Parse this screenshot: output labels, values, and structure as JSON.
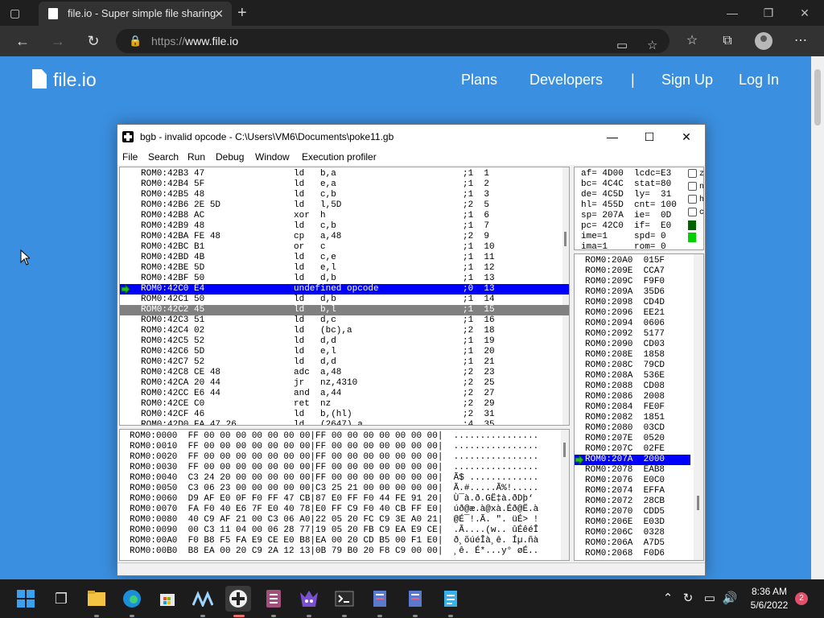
{
  "browser": {
    "tab_title": "file.io - Super simple file sharing",
    "url_scheme": "https://",
    "url_host": "www.file.io",
    "icons": [
      "tab-actions-icon",
      "close-icon",
      "new-tab-icon",
      "back-icon",
      "forward-icon",
      "refresh-icon",
      "lock-icon",
      "immersive-reader-icon",
      "add-favorite-icon",
      "favorites-icon",
      "collections-icon",
      "profile-icon",
      "more-icon"
    ]
  },
  "site": {
    "logo_text": "file.io",
    "nav": [
      "Plans",
      "Developers",
      "|",
      "Sign Up",
      "Log In"
    ]
  },
  "bgb": {
    "title": "bgb - invalid opcode - C:\\Users\\VM6\\Documents\\poke11.gb",
    "menu": [
      "File",
      "Search",
      "Run",
      "Debug",
      "Window",
      "Execution profiler"
    ],
    "disasm": [
      {
        "addr": "ROM0:42B3 47",
        "op": "ld   b,a",
        "cyc": ";1  1"
      },
      {
        "addr": "ROM0:42B4 5F",
        "op": "ld   e,a",
        "cyc": ";1  2"
      },
      {
        "addr": "ROM0:42B5 48",
        "op": "ld   c,b",
        "cyc": ";1  3"
      },
      {
        "addr": "ROM0:42B6 2E 5D",
        "op": "ld   l,5D",
        "cyc": ";2  5"
      },
      {
        "addr": "ROM0:42B8 AC",
        "op": "xor  h",
        "cyc": ";1  6"
      },
      {
        "addr": "ROM0:42B9 48",
        "op": "ld   c,b",
        "cyc": ";1  7"
      },
      {
        "addr": "ROM0:42BA FE 48",
        "op": "cp   a,48",
        "cyc": ";2  9"
      },
      {
        "addr": "ROM0:42BC B1",
        "op": "or   c",
        "cyc": ";1  10"
      },
      {
        "addr": "ROM0:42BD 4B",
        "op": "ld   c,e",
        "cyc": ";1  11"
      },
      {
        "addr": "ROM0:42BE 5D",
        "op": "ld   e,l",
        "cyc": ";1  12"
      },
      {
        "addr": "ROM0:42BF 50",
        "op": "ld   d,b",
        "cyc": ";1  13"
      },
      {
        "addr": "ROM0:42C0 E4",
        "op": "undefined opcode",
        "cyc": ";0  13",
        "state": "selected"
      },
      {
        "addr": "ROM0:42C1 50",
        "op": "ld   d,b",
        "cyc": ";1  14"
      },
      {
        "addr": "ROM0:42C2 45",
        "op": "ld   b,l",
        "cyc": ";1  15",
        "state": "grey"
      },
      {
        "addr": "ROM0:42C3 51",
        "op": "ld   d,c",
        "cyc": ";1  16"
      },
      {
        "addr": "ROM0:42C4 02",
        "op": "ld   (bc),a",
        "cyc": ";2  18"
      },
      {
        "addr": "ROM0:42C5 52",
        "op": "ld   d,d",
        "cyc": ";1  19"
      },
      {
        "addr": "ROM0:42C6 5D",
        "op": "ld   e,l",
        "cyc": ";1  20"
      },
      {
        "addr": "ROM0:42C7 52",
        "op": "ld   d,d",
        "cyc": ";1  21"
      },
      {
        "addr": "ROM0:42C8 CE 48",
        "op": "adc  a,48",
        "cyc": ";2  23"
      },
      {
        "addr": "ROM0:42CA 20 44",
        "op": "jr   nz,4310",
        "cyc": ";2  25"
      },
      {
        "addr": "ROM0:42CC E6 44",
        "op": "and  a,44",
        "cyc": ";2  27"
      },
      {
        "addr": "ROM0:42CE C0",
        "op": "ret  nz",
        "cyc": ";2  29"
      },
      {
        "addr": "ROM0:42CF 46",
        "op": "ld   b,(hl)",
        "cyc": ";2  31"
      },
      {
        "addr": "ROM0:42D0 FA 47 26",
        "op": "ld   (2647),a",
        "cyc": ";4  35"
      }
    ],
    "registers": [
      "af= 4D00  lcdc=E3",
      "bc= 4C4C  stat=80",
      "de= 4C5D  ly=  31",
      "hl= 455D  cnt= 100",
      "sp= 207A  ie=  0D",
      "pc= 42C0  if=  E0",
      "ime=1     spd= 0",
      "ima=1     rom= 0"
    ],
    "flags": [
      "z",
      "n",
      "h",
      "c"
    ],
    "led_colors": [
      "#006400",
      "#00d000"
    ],
    "stack": [
      {
        "t": "ROM0:20A0  015F"
      },
      {
        "t": "ROM0:209E  CCA7"
      },
      {
        "t": "ROM0:209C  F9F0"
      },
      {
        "t": "ROM0:209A  35D6"
      },
      {
        "t": "ROM0:2098  CD4D"
      },
      {
        "t": "ROM0:2096  EE21"
      },
      {
        "t": "ROM0:2094  0606"
      },
      {
        "t": "ROM0:2092  5177"
      },
      {
        "t": "ROM0:2090  CD03"
      },
      {
        "t": "ROM0:208E  1858"
      },
      {
        "t": "ROM0:208C  79CD"
      },
      {
        "t": "ROM0:208A  536E"
      },
      {
        "t": "ROM0:2088  CD08"
      },
      {
        "t": "ROM0:2086  2008"
      },
      {
        "t": "ROM0:2084  FE0F"
      },
      {
        "t": "ROM0:2082  1851"
      },
      {
        "t": "ROM0:2080  03CD"
      },
      {
        "t": "ROM0:207E  0520"
      },
      {
        "t": "ROM0:207C  02FE"
      },
      {
        "t": "ROM0:207A  2000",
        "state": "selected"
      },
      {
        "t": "ROM0:2078  EAB8"
      },
      {
        "t": "ROM0:2076  E0C0"
      },
      {
        "t": "ROM0:2074  EFFA"
      },
      {
        "t": "ROM0:2072  28CB"
      },
      {
        "t": "ROM0:2070  CDD5"
      },
      {
        "t": "ROM0:206E  E03D"
      },
      {
        "t": "ROM0:206C  0328"
      },
      {
        "t": "ROM0:206A  A7D5"
      },
      {
        "t": "ROM0:2068  F0D6"
      }
    ],
    "hex": [
      "ROM0:0000  FF 00 00 00 00 00 00 00|FF 00 00 00 00 00 00 00|  ................",
      "ROM0:0010  FF 00 00 00 00 00 00 00|FF 00 00 00 00 00 00 00|  ................",
      "ROM0:0020  FF 00 00 00 00 00 00 00|FF 00 00 00 00 00 00 00|  ................",
      "ROM0:0030  FF 00 00 00 00 00 00 00|FF 00 00 00 00 00 00 00|  ................",
      "ROM0:0040  C3 24 20 00 00 00 00 00|FF 00 00 00 00 00 00 00|  Ã$ .............",
      "ROM0:0050  C3 06 23 00 00 00 00 00|C3 25 21 00 00 00 00 00|  Ã.#.....Ã%!.....",
      "ROM0:0060  D9 AF E0 0F F0 FF 47 CB|87 E0 FF F0 44 FE 91 20|  Ù¯à.ð.GË‡à.ðDþ‘ ",
      "ROM0:0070  FA F0 40 E6 7F E0 40 78|E0 FF C9 F0 40 CB FF E0|  úð@æ.à@xà.Éð@Ë.à",
      "ROM0:0080  40 C9 AF 21 00 C3 06 A0|22 05 20 FC C9 3E A0 21|  @É¯!.Ã. \". üÉ> !",
      "ROM0:0090  00 C3 11 04 00 06 28 77|19 05 20 FB C9 EA E9 CE|  .Ã....(w.. ûÉêéÎ",
      "ROM0:00A0  F0 B8 F5 FA E9 CE E0 B8|EA 00 20 CD B5 00 F1 E0|  ð¸õúéÎà¸ê. Íµ.ñà",
      "ROM0:00B0  B8 EA 00 20 C9 2A 12 13|0B 79 B0 20 F8 C9 00 00|  ¸ê. É*...y° øÉ.."
    ]
  },
  "taskbar": {
    "apps": [
      "start-icon",
      "task-view-icon",
      "file-explorer-icon",
      "edge-icon",
      "store-icon",
      "app-icon",
      "bgb-icon",
      "editor-icon",
      "game-icon",
      "terminal-icon",
      "note-icon",
      "note-icon",
      "notepad-icon"
    ],
    "time": "8:36 AM",
    "date": "5/6/2022",
    "notifications": "2"
  }
}
